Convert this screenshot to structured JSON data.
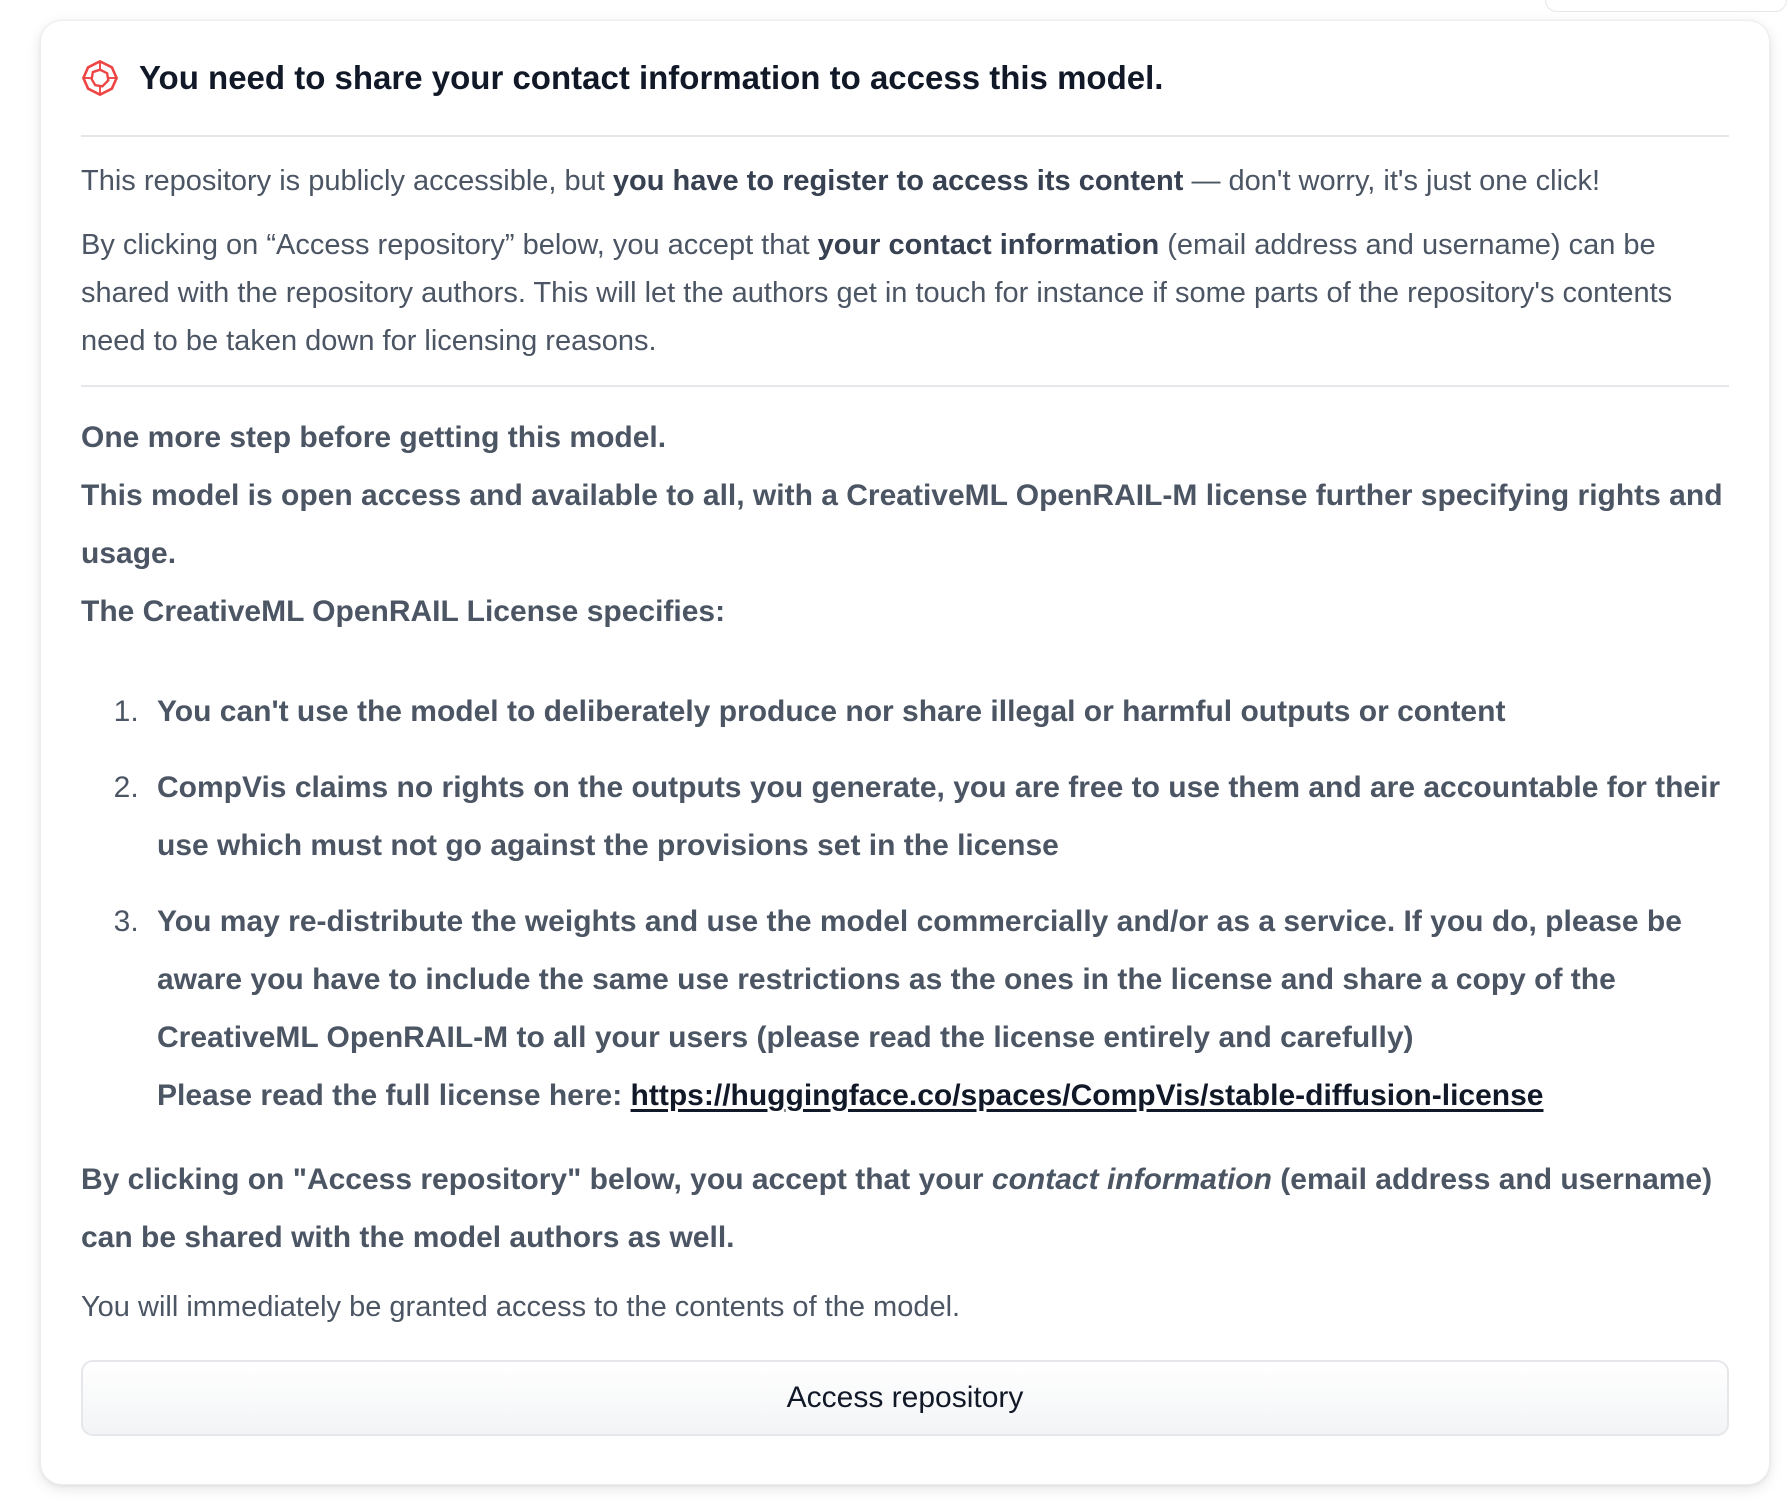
{
  "header": {
    "icon": "warning-octagon-icon",
    "title": "You need to share your contact information to access this model."
  },
  "intro": {
    "p1": {
      "pre": "This repository is publicly accessible, but ",
      "bold": "you have to register to access its content",
      "post": " — don't worry, it's just one click!"
    },
    "p2": {
      "pre": "By clicking on “Access repository” below, you accept that ",
      "bold": "your contact information",
      "post": " (email address and username) can be shared with the repository authors. This will let the authors get in touch for instance if some parts of the repository's contents need to be taken down for licensing reasons."
    }
  },
  "terms": {
    "line1": "One more step before getting this model.",
    "line2": "This model is open access and available to all, with a CreativeML OpenRAIL-M license further specifying rights and usage.",
    "line3": "The CreativeML OpenRAIL License specifies:",
    "items": [
      "You can't use the model to deliberately produce nor share illegal or harmful outputs or content",
      "CompVis claims no rights on the outputs you generate, you are free to use them and are accountable for their use which must not go against the provisions set in the license",
      "You may re-distribute the weights and use the model commercially and/or as a service. If you do, please be aware you have to include the same use restrictions as the ones in the license and share a copy of the CreativeML OpenRAIL-M to all your users (please read the license entirely and carefully)"
    ],
    "license_prefix": "Please read the full license here: ",
    "license_link": "https://huggingface.co/spaces/CompVis/stable-diffusion-license",
    "consent": {
      "pre": "By clicking on \"Access repository\" below, you accept that your ",
      "italic": "contact information",
      "post": " (email address and username) can be shared with the model authors as well."
    }
  },
  "granted": "You will immediately be granted access to the contents of the model.",
  "button": {
    "label": "Access repository"
  },
  "colors": {
    "warning": "#ef4444",
    "text": "#4b5563",
    "title": "#111827"
  }
}
